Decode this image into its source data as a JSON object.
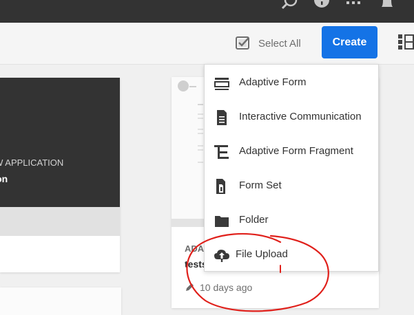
{
  "header": {
    "icons": [
      "search-icon",
      "help-icon",
      "apps-icon",
      "notifications-icon"
    ]
  },
  "actionbar": {
    "select_all": "Select All",
    "create": "Create",
    "view_icon": "view-switcher-icon"
  },
  "left_card": {
    "type": "OW APPLICATION",
    "title": "cation"
  },
  "right_card": {
    "type": "ADA",
    "name": "tests",
    "modified": "10 days ago"
  },
  "create_menu": {
    "items": [
      {
        "label": "Adaptive Form",
        "icon": "adaptive-form-icon"
      },
      {
        "label": "Interactive Communication",
        "icon": "interactive-communication-icon"
      },
      {
        "label": "Adaptive Form Fragment",
        "icon": "adaptive-form-fragment-icon"
      },
      {
        "label": "Form Set",
        "icon": "form-set-icon"
      },
      {
        "label": "Folder",
        "icon": "folder-icon"
      },
      {
        "label": "File Upload",
        "icon": "cloud-upload-icon"
      }
    ]
  },
  "colors": {
    "accent": "#1473e6",
    "topbar": "#333333",
    "annotation": "#e0201b"
  }
}
